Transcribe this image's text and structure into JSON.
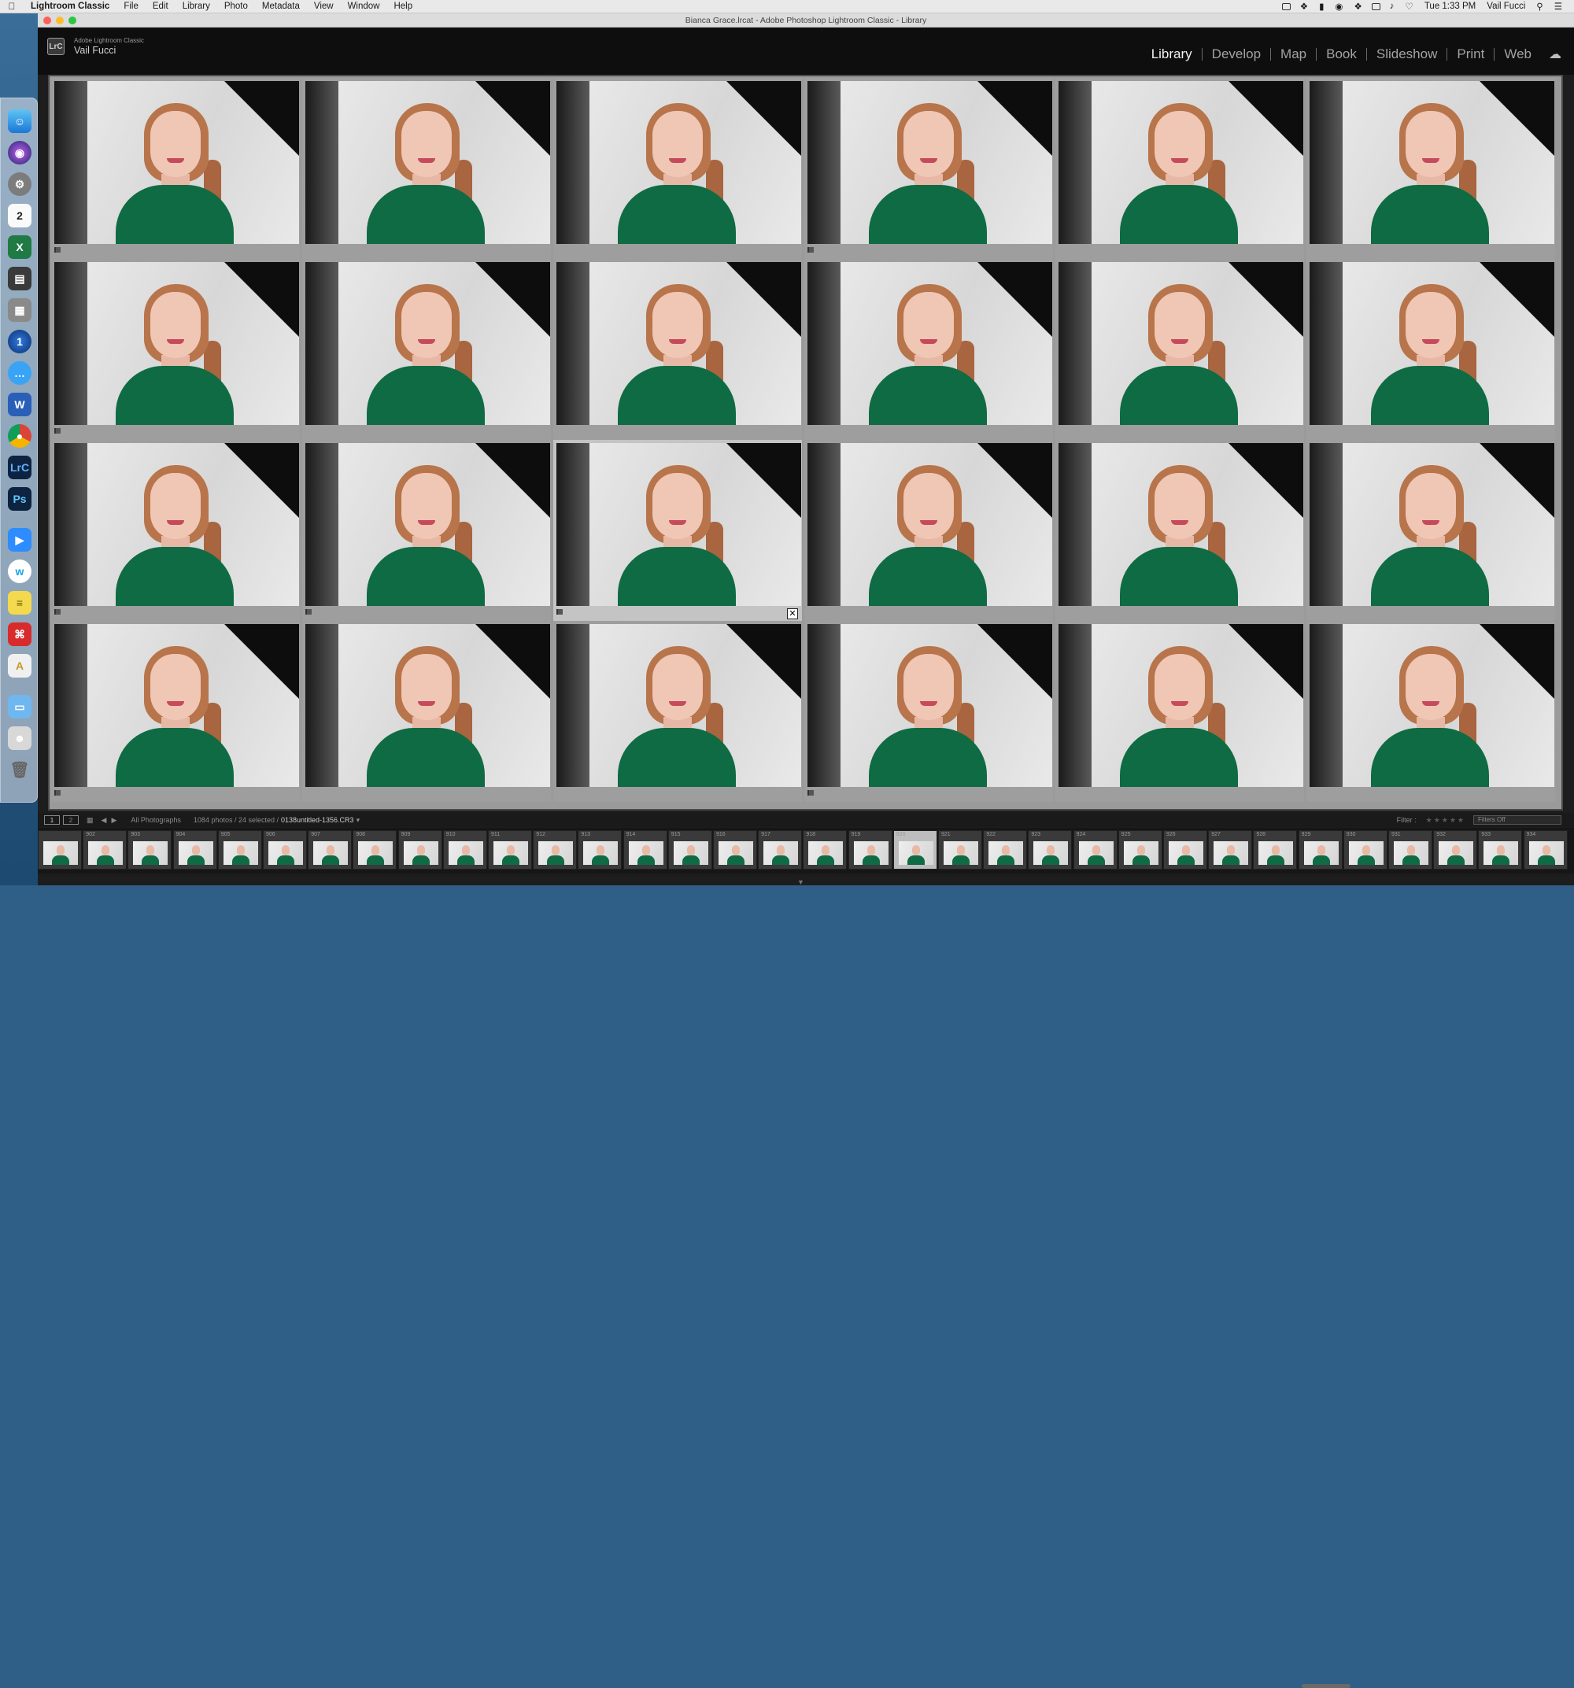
{
  "menubar": {
    "app_name": "Lightroom Classic",
    "items": [
      "File",
      "Edit",
      "Library",
      "Photo",
      "Metadata",
      "View",
      "Window",
      "Help"
    ],
    "clock": "Tue 1:33 PM",
    "user": "Vail Fucci"
  },
  "window": {
    "title": "Bianca Grace.lrcat - Adobe Photoshop Lightroom Classic - Library"
  },
  "identity_plate": {
    "logo": "LrC",
    "product": "Adobe Lightroom Classic",
    "user": "Vail Fucci"
  },
  "modules": [
    "Library",
    "Develop",
    "Map",
    "Book",
    "Slideshow",
    "Print",
    "Web"
  ],
  "active_module": "Library",
  "grid": {
    "rows": 4,
    "cols": 6,
    "selected_index": 14
  },
  "toolbar": {
    "monitor1": "1",
    "monitor2": "2",
    "source": "All Photographs",
    "count": "1084 photos / 24 selected /",
    "filename": "0138untitled-1356.CR3",
    "filter_label": "Filter :",
    "filter_state": "Filters Off"
  },
  "filmstrip": {
    "numbers": [
      "",
      "902",
      "903",
      "904",
      "905",
      "906",
      "907",
      "908",
      "909",
      "910",
      "911",
      "912",
      "913",
      "914",
      "915",
      "916",
      "917",
      "918",
      "919",
      "920",
      "921",
      "922",
      "923",
      "924",
      "925",
      "926",
      "927",
      "928",
      "929",
      "930",
      "931",
      "932",
      "933",
      "934"
    ],
    "selected_index": 19
  },
  "dock": {
    "icons": [
      "finder-icon",
      "siri-icon",
      "system-preferences-icon",
      "calendar-icon",
      "excel-icon",
      "printer-icon",
      "calculator-icon",
      "1password-icon",
      "messages-icon",
      "word-icon",
      "chrome-icon",
      "lightroom-icon",
      "photoshop-icon",
      "zoom-icon",
      "webex-icon",
      "stickies-icon",
      "acrobat-icon",
      "textedit-icon",
      "folder-icon",
      "photo-icon",
      "trash-icon"
    ],
    "labels": {
      "calendar": "2",
      "lightroom": "LrC",
      "photoshop": "Ps",
      "word": "W",
      "excel": "X",
      "onepassword": "1"
    }
  }
}
